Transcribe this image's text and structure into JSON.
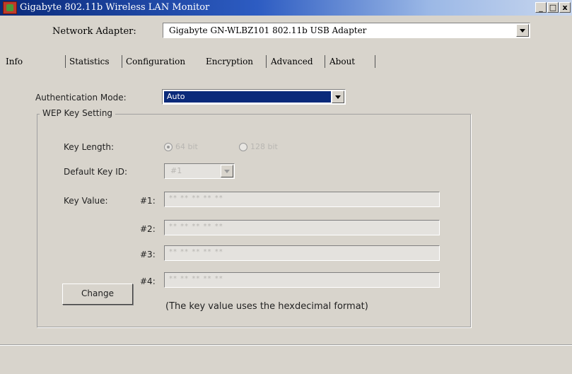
{
  "window": {
    "title": "Gigabyte 802.11b Wireless LAN Monitor",
    "controls": {
      "minimize": "_",
      "maximize": "□",
      "close": "x"
    }
  },
  "adapter": {
    "label": "Network Adapter:",
    "value": "Gigabyte GN-WLBZ101 802.11b USB Adapter"
  },
  "tabs": [
    {
      "label": "Info"
    },
    {
      "label": "Statistics"
    },
    {
      "label": "Configuration"
    },
    {
      "label": "Encryption",
      "selected": true
    },
    {
      "label": "Advanced"
    },
    {
      "label": "About"
    }
  ],
  "encryption": {
    "auth_label": "Authentication Mode:",
    "auth_value": "Auto",
    "group_title": "WEP Key Setting",
    "key_length_label": "Key Length:",
    "key_length_options": [
      "64 bit",
      "128 bit"
    ],
    "key_length_selected": "64 bit",
    "default_key_label": "Default Key ID:",
    "default_key_value": "#1",
    "key_value_label": "Key Value:",
    "keys": [
      {
        "label": "#1:",
        "value": "** ** ** ** **"
      },
      {
        "label": "#2:",
        "value": "** ** ** ** **"
      },
      {
        "label": "#3:",
        "value": "** ** ** ** **"
      },
      {
        "label": "#4:",
        "value": "** ** ** ** **"
      }
    ],
    "change_button": "Change",
    "hint": "(The key value uses the hexdecimal format)"
  }
}
